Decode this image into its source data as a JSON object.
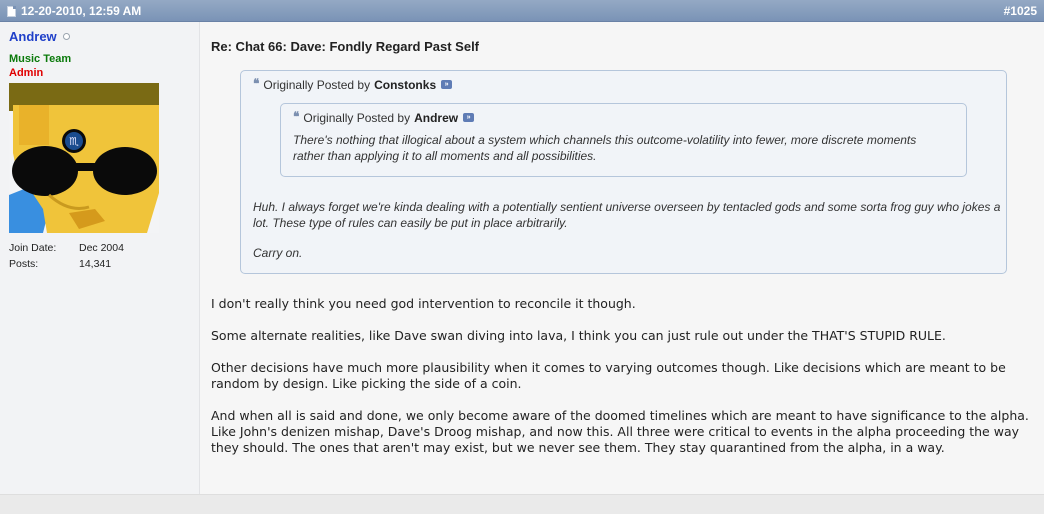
{
  "post": {
    "date": "12-20-2010, 12:59 AM",
    "number": "#1025",
    "title": "Re: Chat 66: Dave: Fondly Regard Past Self"
  },
  "user": {
    "name": "Andrew",
    "title1": "Music Team",
    "title2": "Admin",
    "join_label": "Join Date:",
    "join_value": "Dec 2004",
    "posts_label": "Posts:",
    "posts_value": "14,341",
    "colors": {
      "name": "#1f3fc9",
      "title1": "#0b7a0b",
      "title2": "#e00000"
    }
  },
  "quote_outer": {
    "prefix": "Originally Posted by",
    "author": "Constonks",
    "text1": "Huh. I always forget we're kinda dealing with a potentially sentient universe overseen by tentacled gods and some sorta frog guy who jokes a lot. These type of rules can easily be put in place arbitrarily.",
    "text2": "Carry on."
  },
  "quote_inner": {
    "prefix": "Originally Posted by",
    "author": "Andrew",
    "text": "There's nothing that illogical about a system which channels this outcome-volatility into fewer, more discrete moments rather than applying it to all moments and all possibilities."
  },
  "body": {
    "p1": "I don't really think you need god intervention to reconcile it though.",
    "p2": "Some alternate realities, like Dave swan diving into lava, I think you can just rule out under the THAT'S STUPID RULE.",
    "p3": "Other decisions have much more plausibility when it comes to varying outcomes though. Like decisions which are meant to be random by design. Like picking the side of a coin.",
    "p4": "And when all is said and done, we only become aware of the doomed timelines which are meant to have significance to the alpha. Like John's denizen mishap, Dave's Droog mishap, and now this. All three were critical to events in the alpha proceeding the way they should. The ones that aren't may exist, but we never see them. They stay quarantined from the alpha, in a way."
  },
  "icons": {
    "post_icon": "document-icon",
    "online_status": "offline-status-icon",
    "quote_mark": "quote-icon",
    "view_post": "view-post-icon"
  }
}
